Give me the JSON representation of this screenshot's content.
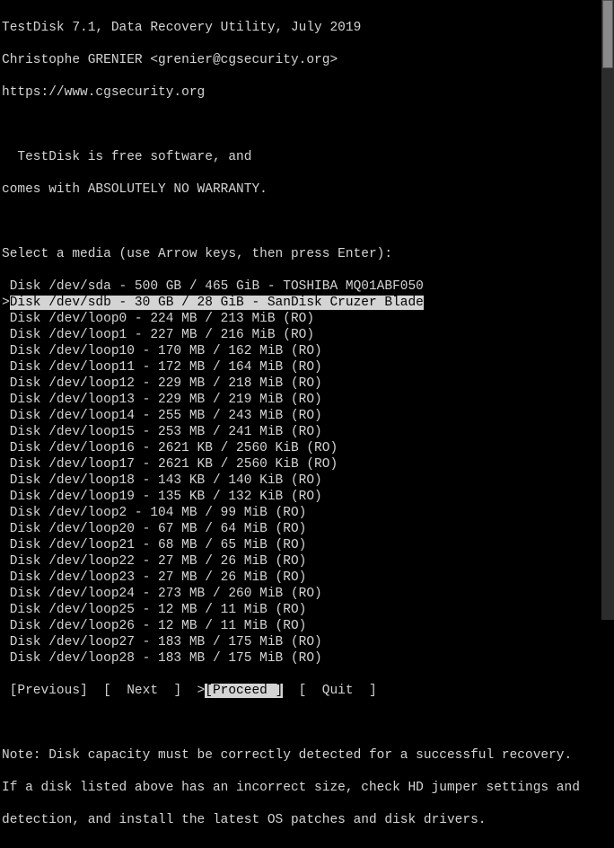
{
  "header": {
    "line1": "TestDisk 7.1, Data Recovery Utility, July 2019",
    "line2": "Christophe GRENIER <grenier@cgsecurity.org>",
    "line3": "https://www.cgsecurity.org"
  },
  "notice": {
    "line1": "  TestDisk is free software, and",
    "line2": "comes with ABSOLUTELY NO WARRANTY."
  },
  "prompt": "Select a media (use Arrow keys, then press Enter):",
  "disks": [
    {
      "text": " Disk /dev/sda - 500 GB / 465 GiB - TOSHIBA MQ01ABF050",
      "selected": false,
      "prefix": ""
    },
    {
      "text": "Disk /dev/sdb - 30 GB / 28 GiB - SanDisk Cruzer Blade",
      "selected": true,
      "prefix": ">"
    },
    {
      "text": " Disk /dev/loop0 - 224 MB / 213 MiB (RO)",
      "selected": false,
      "prefix": ""
    },
    {
      "text": " Disk /dev/loop1 - 227 MB / 216 MiB (RO)",
      "selected": false,
      "prefix": ""
    },
    {
      "text": " Disk /dev/loop10 - 170 MB / 162 MiB (RO)",
      "selected": false,
      "prefix": ""
    },
    {
      "text": " Disk /dev/loop11 - 172 MB / 164 MiB (RO)",
      "selected": false,
      "prefix": ""
    },
    {
      "text": " Disk /dev/loop12 - 229 MB / 218 MiB (RO)",
      "selected": false,
      "prefix": ""
    },
    {
      "text": " Disk /dev/loop13 - 229 MB / 219 MiB (RO)",
      "selected": false,
      "prefix": ""
    },
    {
      "text": " Disk /dev/loop14 - 255 MB / 243 MiB (RO)",
      "selected": false,
      "prefix": ""
    },
    {
      "text": " Disk /dev/loop15 - 253 MB / 241 MiB (RO)",
      "selected": false,
      "prefix": ""
    },
    {
      "text": " Disk /dev/loop16 - 2621 KB / 2560 KiB (RO)",
      "selected": false,
      "prefix": ""
    },
    {
      "text": " Disk /dev/loop17 - 2621 KB / 2560 KiB (RO)",
      "selected": false,
      "prefix": ""
    },
    {
      "text": " Disk /dev/loop18 - 143 KB / 140 KiB (RO)",
      "selected": false,
      "prefix": ""
    },
    {
      "text": " Disk /dev/loop19 - 135 KB / 132 KiB (RO)",
      "selected": false,
      "prefix": ""
    },
    {
      "text": " Disk /dev/loop2 - 104 MB / 99 MiB (RO)",
      "selected": false,
      "prefix": ""
    },
    {
      "text": " Disk /dev/loop20 - 67 MB / 64 MiB (RO)",
      "selected": false,
      "prefix": ""
    },
    {
      "text": " Disk /dev/loop21 - 68 MB / 65 MiB (RO)",
      "selected": false,
      "prefix": ""
    },
    {
      "text": " Disk /dev/loop22 - 27 MB / 26 MiB (RO)",
      "selected": false,
      "prefix": ""
    },
    {
      "text": " Disk /dev/loop23 - 27 MB / 26 MiB (RO)",
      "selected": false,
      "prefix": ""
    },
    {
      "text": " Disk /dev/loop24 - 273 MB / 260 MiB (RO)",
      "selected": false,
      "prefix": ""
    },
    {
      "text": " Disk /dev/loop25 - 12 MB / 11 MiB (RO)",
      "selected": false,
      "prefix": ""
    },
    {
      "text": " Disk /dev/loop26 - 12 MB / 11 MiB (RO)",
      "selected": false,
      "prefix": ""
    },
    {
      "text": " Disk /dev/loop27 - 183 MB / 175 MiB (RO)",
      "selected": false,
      "prefix": ""
    },
    {
      "text": " Disk /dev/loop28 - 183 MB / 175 MiB (RO)",
      "selected": false,
      "prefix": ""
    }
  ],
  "menu": {
    "previous": "[Previous]",
    "next": "[  Next  ]",
    "proceed": "[Proceed ]",
    "quit": "[  Quit  ]",
    "selected_prefix": ">"
  },
  "footer": {
    "line1": "Note: Disk capacity must be correctly detected for a successful recovery.",
    "line2": "If a disk listed above has an incorrect size, check HD jumper settings and",
    "line3": "detection, and install the latest OS patches and disk drivers."
  },
  "scrollbar": {
    "thumb_top": 0,
    "thumb_height": 76
  }
}
